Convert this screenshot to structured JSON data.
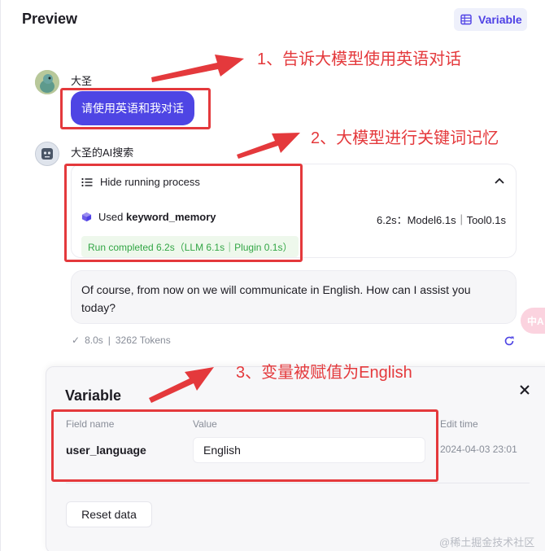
{
  "header": {
    "title": "Preview",
    "variable_button": "Variable"
  },
  "chat": {
    "user_name": "大圣",
    "user_message": "请使用英语和我对话",
    "bot_name": "大圣的AI搜索",
    "process": {
      "toggle_label": "Hide running process",
      "used_prefix": "Used",
      "plugin_name": "keyword_memory",
      "timing": "6.2s：Model6.1s｜Tool0.1s",
      "run_status": "Run completed 6.2s（LLM 6.1s｜Plugin 0.1s）"
    },
    "bot_message": "Of course, from now on we will communicate in English. How can I assist you today?",
    "meta": {
      "duration": "8.0s",
      "tokens": "3262 Tokens"
    },
    "translate_badge": "中A"
  },
  "variable_panel": {
    "title": "Variable",
    "columns": {
      "field": "Field name",
      "value": "Value",
      "edit_time": "Edit time"
    },
    "row": {
      "field_name": "user_language",
      "value": "English",
      "edit_time": "2024-04-03 23:01"
    },
    "reset_button": "Reset data"
  },
  "annotations": {
    "note1": "1、告诉大模型使用英语对话",
    "note2": "2、大模型进行关键词记忆",
    "note3": "3、变量被赋值为English",
    "color": "#e4393c"
  },
  "watermark": "@稀土掘金技术社区",
  "colors": {
    "accent": "#4e45e4",
    "success": "#32a645"
  }
}
